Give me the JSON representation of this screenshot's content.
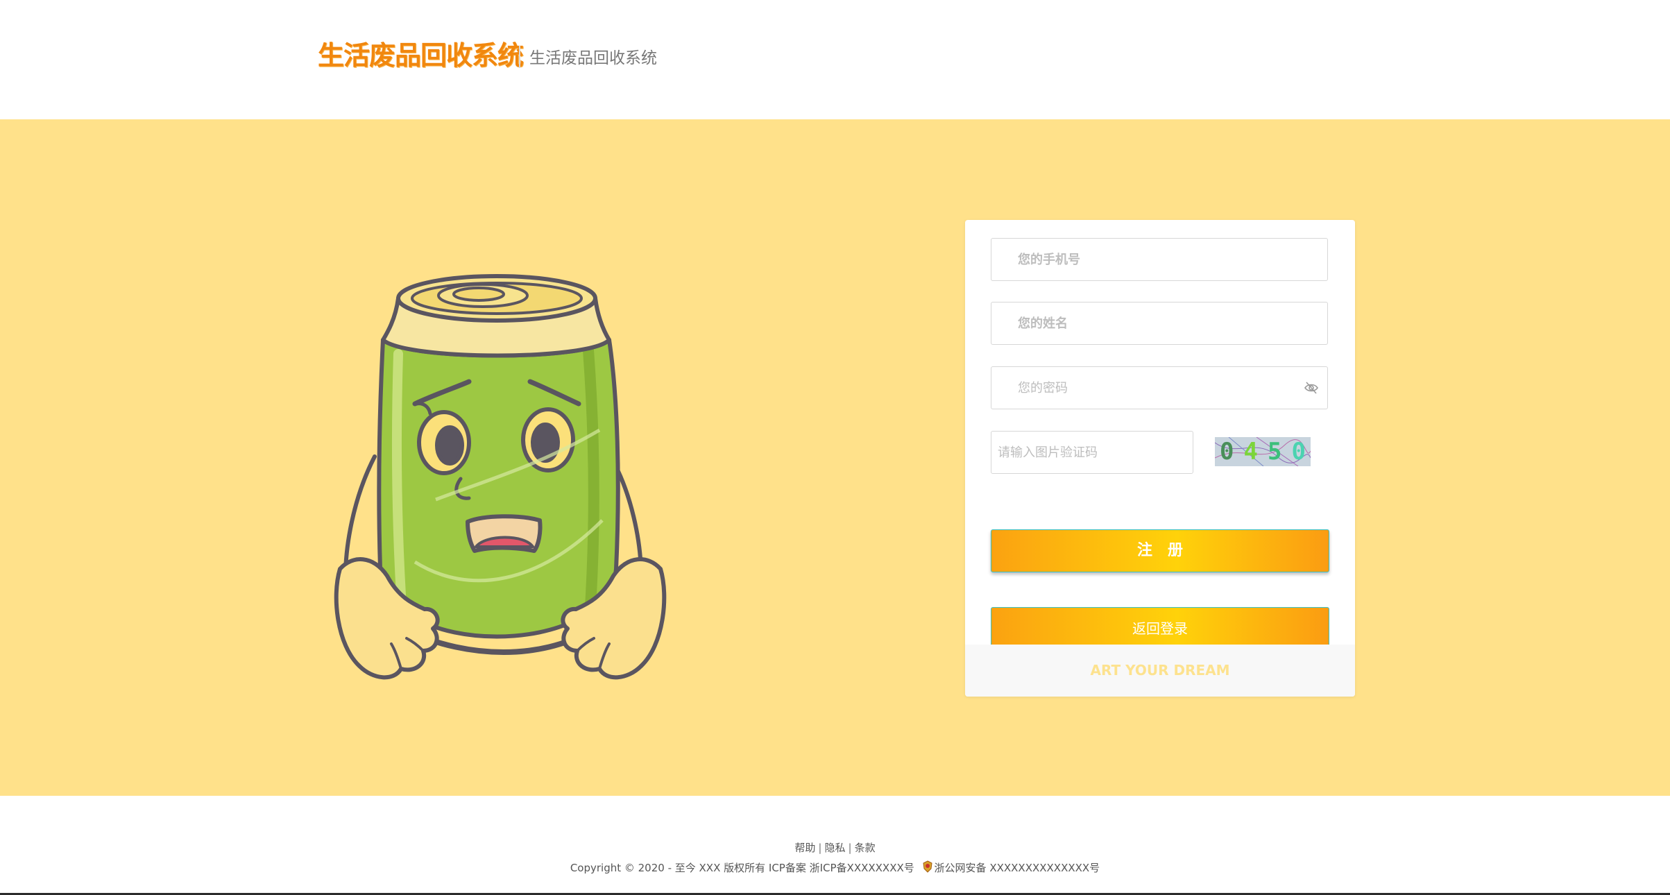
{
  "header": {
    "brand_logo_text": "生活废品回收系统",
    "brand_subtitle": "生活废品回收系统"
  },
  "form": {
    "phone_placeholder": "您的手机号",
    "name_placeholder": "您的姓名",
    "password_placeholder": "您的密码",
    "captcha_placeholder": "请输入图片验证码",
    "captcha_digits": [
      "0",
      "4",
      "5",
      "0"
    ],
    "register_label": "注　册",
    "back_login_label": "返回登录",
    "slogan": "ART YOUR DREAM"
  },
  "footer": {
    "links": [
      "帮助",
      "隐私",
      "条款"
    ],
    "copyright": "Copyright © 2020 - 至今 XXX 版权所有 ICP备案 浙ICP备XXXXXXXX号",
    "police_record": "浙公网安备 XXXXXXXXXXXXXX号"
  },
  "colors": {
    "hero_bg": "#ffe18a",
    "brand": "#f1870e",
    "button_start": "#fba211",
    "button_mid": "#ffd20a",
    "button_border": "#36c1c8",
    "slogan": "#fde28e"
  },
  "icons": {
    "password_toggle": "eye-off-icon",
    "police_badge": "police-badge-icon",
    "mascot": "worried-soda-can-mascot"
  }
}
